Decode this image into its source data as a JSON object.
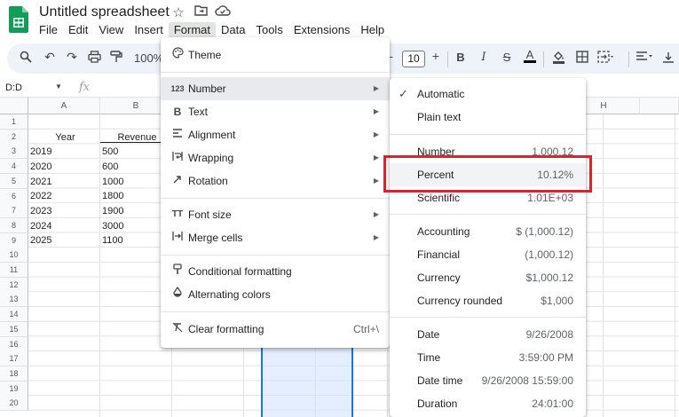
{
  "app": {
    "title": "Untitled spreadsheet",
    "title_icons": [
      "star-icon",
      "move-folder-icon",
      "cloud-status-icon"
    ],
    "brand_color": "#0f9d58"
  },
  "menubar": [
    "File",
    "Edit",
    "View",
    "Insert",
    "Format",
    "Data",
    "Tools",
    "Extensions",
    "Help"
  ],
  "toolbar": {
    "zoom": "100%",
    "font_size": "10",
    "icons": [
      "search-icon",
      "undo-icon",
      "redo-icon",
      "print-icon",
      "paint-format-icon",
      "minus-icon",
      "plus-icon",
      "bold-icon",
      "italic-icon",
      "strikethrough-icon",
      "text-color-icon",
      "fill-color-icon",
      "borders-icon",
      "merge-cells-icon",
      "align-icon"
    ]
  },
  "formula_bar": {
    "name_box": "D:D",
    "fx_label": "fx"
  },
  "grid": {
    "columns": [
      "A",
      "B",
      "",
      "",
      "",
      "",
      "",
      "",
      "H",
      ""
    ],
    "rows": [
      "1",
      "2",
      "3",
      "4",
      "5",
      "6",
      "7",
      "8",
      "9",
      "10",
      "11",
      "12",
      "13",
      "14",
      "15",
      "16",
      "17",
      "18",
      "19",
      "20"
    ],
    "header_cells": [
      "Year",
      "Revenue"
    ],
    "data": [
      [
        "2019",
        "500"
      ],
      [
        "2020",
        "600"
      ],
      [
        "2021",
        "1000"
      ],
      [
        "2022",
        "1800"
      ],
      [
        "2023",
        "1900"
      ],
      [
        "2024",
        "3000"
      ],
      [
        "2025",
        "1100"
      ]
    ]
  },
  "format_menu": {
    "items": [
      {
        "icon": "palette-icon",
        "label": "Theme"
      },
      {
        "icon": "number-format-icon",
        "label": "Number",
        "submenu": true,
        "icon_text": "123"
      },
      {
        "icon": "bold-icon",
        "label": "Text",
        "submenu": true,
        "icon_text": "B"
      },
      {
        "icon": "alignment-icon",
        "label": "Alignment",
        "submenu": true
      },
      {
        "icon": "wrapping-icon",
        "label": "Wrapping",
        "submenu": true
      },
      {
        "icon": "rotation-icon",
        "label": "Rotation",
        "submenu": true
      },
      {
        "icon": "font-size-icon",
        "label": "Font size",
        "submenu": true,
        "icon_text": "TT"
      },
      {
        "icon": "merge-cells-icon",
        "label": "Merge cells",
        "submenu": true
      },
      {
        "icon": "conditional-formatting-icon",
        "label": "Conditional formatting"
      },
      {
        "icon": "alternating-colors-icon",
        "label": "Alternating colors"
      },
      {
        "icon": "clear-formatting-icon",
        "label": "Clear formatting",
        "shortcut": "Ctrl+\\"
      }
    ]
  },
  "number_menu": {
    "items": [
      {
        "label": "Automatic",
        "checked": true,
        "value": ""
      },
      {
        "label": "Plain text",
        "value": ""
      },
      {
        "label": "Number",
        "value": "1,000.12"
      },
      {
        "label": "Percent",
        "value": "10.12%"
      },
      {
        "label": "Scientific",
        "value": "1.01E+03"
      },
      {
        "label": "Accounting",
        "value": "$ (1,000.12)"
      },
      {
        "label": "Financial",
        "value": "(1,000.12)"
      },
      {
        "label": "Currency",
        "value": "$1,000.12"
      },
      {
        "label": "Currency rounded",
        "value": "$1,000"
      },
      {
        "label": "Date",
        "value": "9/26/2008"
      },
      {
        "label": "Time",
        "value": "3:59:00 PM"
      },
      {
        "label": "Date time",
        "value": "9/26/2008 15:59:00"
      },
      {
        "label": "Duration",
        "value": "24:01:00"
      }
    ],
    "highlight_color": "#d9232d"
  }
}
